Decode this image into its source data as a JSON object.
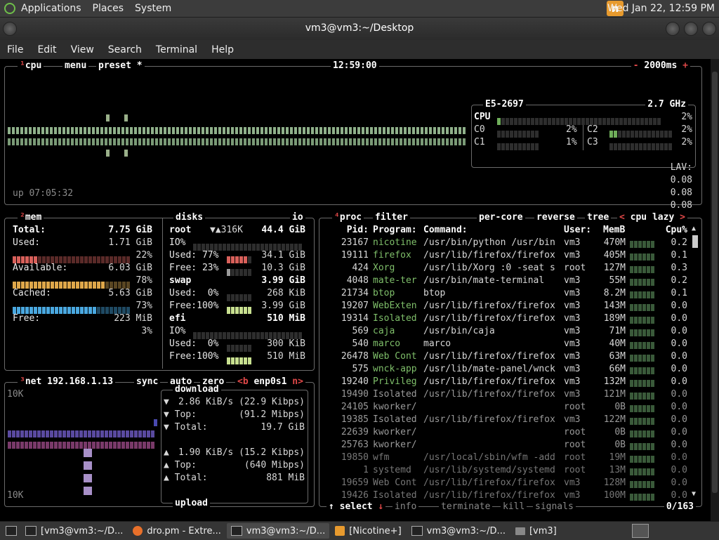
{
  "panel": {
    "menus": [
      "Applications",
      "Places",
      "System"
    ],
    "clock": "Wed Jan 22, 12:59 PM",
    "tray_icon": "n"
  },
  "window": {
    "title": "vm3@vm3:~/Desktop",
    "menu": [
      "File",
      "Edit",
      "View",
      "Search",
      "Terminal",
      "Help"
    ]
  },
  "cpu_box": {
    "tabs": [
      "cpu",
      "menu",
      "preset"
    ],
    "preset_mark": "*",
    "time": "12:59:00",
    "interval_minus": "-",
    "interval": "2000ms",
    "interval_plus": "+",
    "uptime": "up 07:05:32",
    "model": "E5-2697",
    "freq": "2.7 GHz",
    "total_label": "CPU",
    "total_pct": "2%",
    "cores": [
      {
        "name": "C0",
        "pct": "2%"
      },
      {
        "name": "C1",
        "pct": "1%"
      },
      {
        "name": "C2",
        "pct": "2%"
      },
      {
        "name": "C3",
        "pct": "2%"
      }
    ],
    "lav_label": "LAV:",
    "lav": [
      "0.08",
      "0.08",
      "0.08"
    ]
  },
  "mem_box": {
    "title": "mem",
    "rows": [
      {
        "label": "Total:",
        "value": "7.75 GiB"
      },
      {
        "label": "Used:",
        "value": "1.71 GiB",
        "pct": "22%",
        "color": "#d8605a",
        "fill": 0.22
      },
      {
        "label": "Available:",
        "value": "6.03 GiB",
        "pct": "78%",
        "color": "#e0a84a",
        "fill": 0.78
      },
      {
        "label": "Cached:",
        "value": "5.63 GiB",
        "pct": "73%",
        "color": "#4aa8e0",
        "fill": 0.73
      },
      {
        "label": "Free:",
        "value": "223 MiB",
        "pct": "3%",
        "color": "#a0a0a0",
        "fill": 0.03
      }
    ]
  },
  "disks_box": {
    "title": "disks",
    "io_tab": "io",
    "root": {
      "name": "root",
      "io_speed": "▼▲316K",
      "size": "44.4 GiB",
      "io": "IO%",
      "used_label": "Used: 77%",
      "used": "34.1 GiB",
      "free_label": "Free: 23%",
      "free": "10.3 GiB"
    },
    "swap": {
      "name": "swap",
      "size": "3.99 GiB",
      "used_label": "Used:  0%",
      "used": "268 KiB",
      "free_label": "Free:100%",
      "free": "3.99 GiB"
    },
    "efi": {
      "name": "efi",
      "size": "510 MiB",
      "io": "IO%",
      "used_label": "Used:  0%",
      "used": "300 KiB",
      "free_label": "Free:100%",
      "free": "510 MiB"
    }
  },
  "net_box": {
    "title": "net",
    "ip": "192.168.1.13",
    "tabs": [
      "sync",
      "auto",
      "zero",
      "<b",
      "enp0s1",
      "n>"
    ],
    "scale_top": "10K",
    "scale_bottom": "10K",
    "download_label": "download",
    "upload_label": "upload",
    "dl_rate": "2.86 KiB/s",
    "dl_rate_bits": "(22.9 Kibps)",
    "dl_top_label": "Top:",
    "dl_top": "(91.2 Mibps)",
    "dl_total_label": "Total:",
    "dl_total": "19.7 GiB",
    "ul_rate": "1.90 KiB/s",
    "ul_rate_bits": "(15.2 Kibps)",
    "ul_top_label": "Top:",
    "ul_top": "(640 Mibps)",
    "ul_total_label": "Total:",
    "ul_total": "881 MiB",
    "arrow_down": "▼",
    "arrow_up": "▲"
  },
  "proc_box": {
    "tabs": [
      "proc",
      "filter",
      "per-core",
      "reverse",
      "tree"
    ],
    "sort_left": "<",
    "sort": "cpu lazy",
    "sort_right": ">",
    "headers": [
      "Pid:",
      "Program:",
      "Command:",
      "User:",
      "MemB",
      "Cpu%"
    ],
    "rows": [
      [
        "23167",
        "nicotine",
        "/usr/bin/python /usr/bin",
        "vm3",
        "470M",
        "0.2"
      ],
      [
        "19111",
        "firefox",
        "/usr/lib/firefox/firefox",
        "vm3",
        "405M",
        "0.1"
      ],
      [
        "424",
        "Xorg",
        "/usr/lib/Xorg :0 -seat s",
        "root",
        "127M",
        "0.3"
      ],
      [
        "4048",
        "mate-ter",
        "/usr/bin/mate-terminal",
        "vm3",
        "55M",
        "0.2"
      ],
      [
        "21734",
        "btop",
        "btop",
        "vm3",
        "8.2M",
        "0.1"
      ],
      [
        "19207",
        "WebExten",
        "/usr/lib/firefox/firefox",
        "vm3",
        "143M",
        "0.0"
      ],
      [
        "19314",
        "Isolated",
        "/usr/lib/firefox/firefox",
        "vm3",
        "189M",
        "0.0"
      ],
      [
        "569",
        "caja",
        "/usr/bin/caja",
        "vm3",
        "71M",
        "0.0"
      ],
      [
        "540",
        "marco",
        "marco",
        "vm3",
        "40M",
        "0.0"
      ],
      [
        "26478",
        "Web Cont",
        "/usr/lib/firefox/firefox",
        "vm3",
        "63M",
        "0.0"
      ],
      [
        "575",
        "wnck-app",
        "/usr/lib/mate-panel/wnck",
        "vm3",
        "66M",
        "0.0"
      ],
      [
        "19240",
        "Privileg",
        "/usr/lib/firefox/firefox",
        "vm3",
        "132M",
        "0.0"
      ],
      [
        "19490",
        "Isolated",
        "/usr/lib/firefox/firefox",
        "vm3",
        "121M",
        "0.0"
      ],
      [
        "24105",
        "kworker/",
        "",
        "root",
        "0B",
        "0.0"
      ],
      [
        "19385",
        "Isolated",
        "/usr/lib/firefox/firefox",
        "vm3",
        "122M",
        "0.0"
      ],
      [
        "22639",
        "kworker/",
        "",
        "root",
        "0B",
        "0.0"
      ],
      [
        "25763",
        "kworker/",
        "",
        "root",
        "0B",
        "0.0"
      ],
      [
        "19850",
        "wfm",
        "/usr/local/sbin/wfm -add",
        "root",
        "19M",
        "0.0"
      ],
      [
        "1",
        "systemd",
        "/usr/lib/systemd/systemd",
        "root",
        "13M",
        "0.0"
      ],
      [
        "19659",
        "Web Cont",
        "/usr/lib/firefox/firefox",
        "vm3",
        "128M",
        "0.0"
      ],
      [
        "19426",
        "Isolated",
        "/usr/lib/firefox/firefox",
        "vm3",
        "100M",
        "0.0"
      ]
    ],
    "footer": [
      "select",
      "info",
      "terminate",
      "kill",
      "signals"
    ],
    "count": "0/163"
  },
  "taskbar": {
    "tasks": [
      {
        "label": "[vm3@vm3:~/D...",
        "active": false
      },
      {
        "label": "dro.pm - Extre...",
        "active": false
      },
      {
        "label": "vm3@vm3:~/D...",
        "active": true
      },
      {
        "label": "[Nicotine+]",
        "active": false
      },
      {
        "label": "vm3@vm3:~/D...",
        "active": false
      },
      {
        "label": "[vm3]",
        "active": false
      }
    ]
  }
}
